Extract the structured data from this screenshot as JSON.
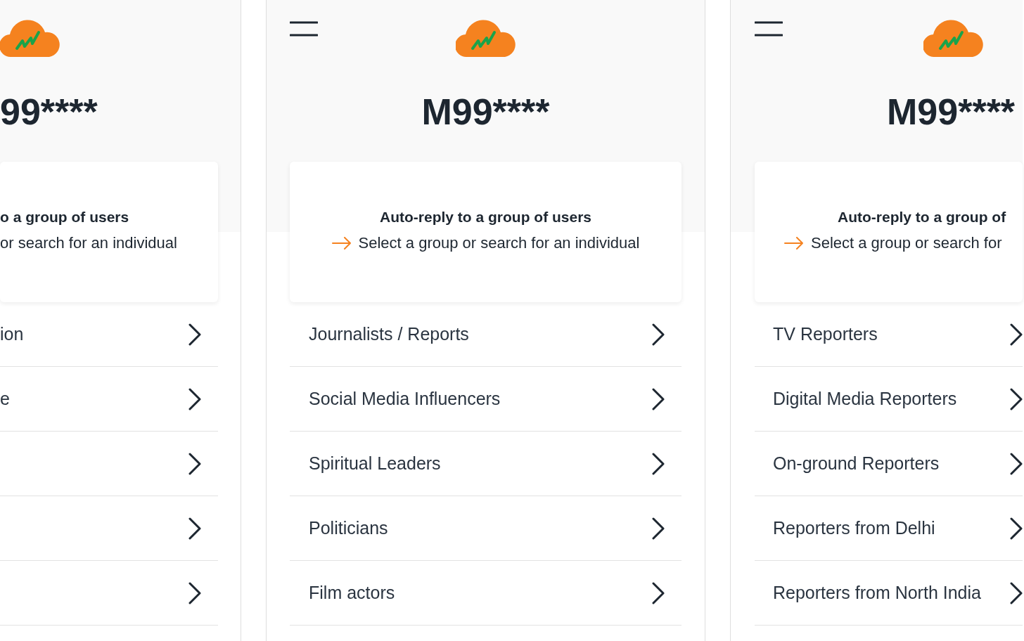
{
  "panels": [
    {
      "kind": "cut-left",
      "menu": false,
      "title": "99****",
      "card": {
        "heading": "o a group of users",
        "arrow": false,
        "hint": "or search for an individual"
      },
      "items": [
        {
          "kind": "labeled",
          "label": "ion"
        },
        {
          "kind": "labeled",
          "label": "e"
        },
        {
          "kind": "blank"
        },
        {
          "kind": "blank"
        },
        {
          "kind": "blank"
        }
      ]
    },
    {
      "kind": "full",
      "menu": true,
      "title": "M99****",
      "card": {
        "heading": "Auto-reply to a group of users",
        "arrow": true,
        "hint": "Select a group or search for an individual"
      },
      "items": [
        {
          "kind": "labeled",
          "label": "Journalists / Reports"
        },
        {
          "kind": "labeled",
          "label": "Social Media Influencers"
        },
        {
          "kind": "labeled",
          "label": "Spiritual Leaders"
        },
        {
          "kind": "labeled",
          "label": "Politicians"
        },
        {
          "kind": "labeled",
          "label": "Film actors"
        }
      ]
    },
    {
      "kind": "cut-right",
      "menu": true,
      "title": "M99****",
      "card": {
        "heading": "Auto-reply to a group of",
        "arrow": true,
        "hint": "Select a group or search for"
      },
      "items": [
        {
          "kind": "labeled",
          "label": "TV Reporters"
        },
        {
          "kind": "labeled",
          "label": "Digital Media Reporters"
        },
        {
          "kind": "labeled",
          "label": "On-ground Reporters"
        },
        {
          "kind": "labeled",
          "label": "Reporters from Delhi"
        },
        {
          "kind": "labeled",
          "label": "Reporters from North India"
        }
      ]
    }
  ]
}
